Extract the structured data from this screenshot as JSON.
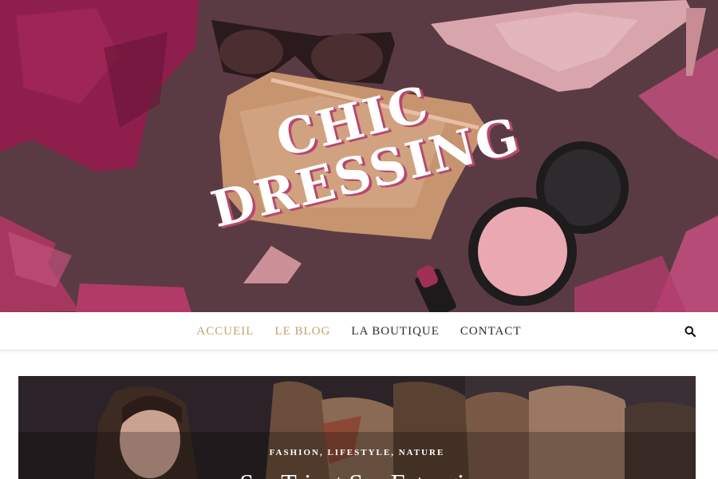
{
  "header": {
    "logo_line1": "CHIC",
    "logo_line2": "DRESSING"
  },
  "nav": {
    "items": [
      {
        "label": "ACCUEIL"
      },
      {
        "label": "LE BLOG"
      },
      {
        "label": "LA BOUTIQUE"
      },
      {
        "label": "CONTACT"
      }
    ],
    "search_icon": "search-icon"
  },
  "featured_post": {
    "categories": [
      "FASHION",
      "LIFESTYLE",
      "NATURE"
    ],
    "category_separator": ", ",
    "title": "Sur Tricot Sur Estrogis"
  },
  "colors": {
    "accent": "#c6a06c",
    "nav_text": "#2b2b2b",
    "hero_bg": "#5a3a42",
    "logo_shadow": "#b8486e"
  }
}
